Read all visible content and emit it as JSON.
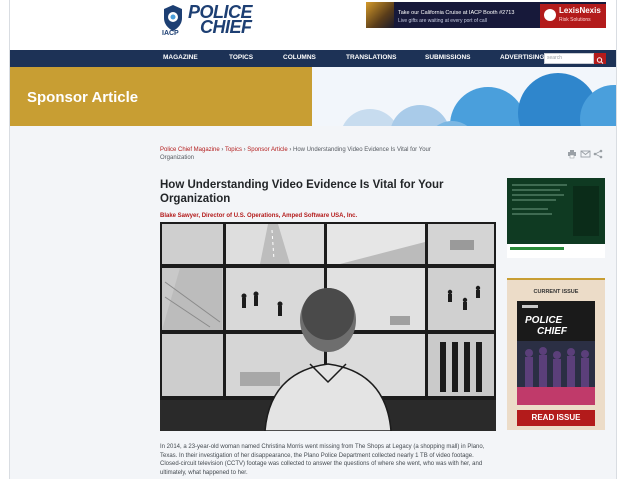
{
  "header": {
    "logo": {
      "org": "IACP",
      "word1": "POLICE",
      "word2": "CHIEF"
    },
    "banner": {
      "line1": "",
      "line2": "Take our California Cruise at IACP Booth #2713",
      "line3": "Live gifts are waiting at every port of call",
      "brand": "LexisNexis",
      "brand_sub": "Risk Solutions"
    }
  },
  "nav": {
    "items": [
      "MAGAZINE",
      "TOPICS",
      "COLUMNS",
      "TRANSLATIONS",
      "SUBMISSIONS",
      "ADVERTISING"
    ],
    "search_placeholder": "search"
  },
  "hero": {
    "title": "Sponsor Article"
  },
  "breadcrumb": {
    "items": [
      "Police Chief Magazine",
      "Topics",
      "Sponsor Article"
    ],
    "separator": "›",
    "current": "How Understanding Video Evidence Is Vital for Your Organization"
  },
  "article": {
    "title": "How Understanding Video Evidence Is Vital for Your Organization",
    "byline": "Blake Sawyer, Director of U.S. Operations, Amped Software USA, Inc.",
    "body": "In 2014, a 23-year-old woman named Christina Morris went missing from The Shops at Legacy (a shopping mall) in Plano, Texas. In their investigation of her disappearance, the Plano Police Department collected nearly 1 TB of video footage. Closed-circuit television (CCTV) footage was collected to answer the questions of where she went, who was with her, and ultimately, what happened to her."
  },
  "sidebar": {
    "current_issue_label": "CURRENT ISSUE",
    "cover_brand1": "POLICE",
    "cover_brand2": "CHIEF",
    "read_button": "READ ISSUE"
  },
  "colors": {
    "navy": "#1d3256",
    "gold": "#c89e33",
    "red": "#b31b1b",
    "sky": "#4a9fdc"
  }
}
